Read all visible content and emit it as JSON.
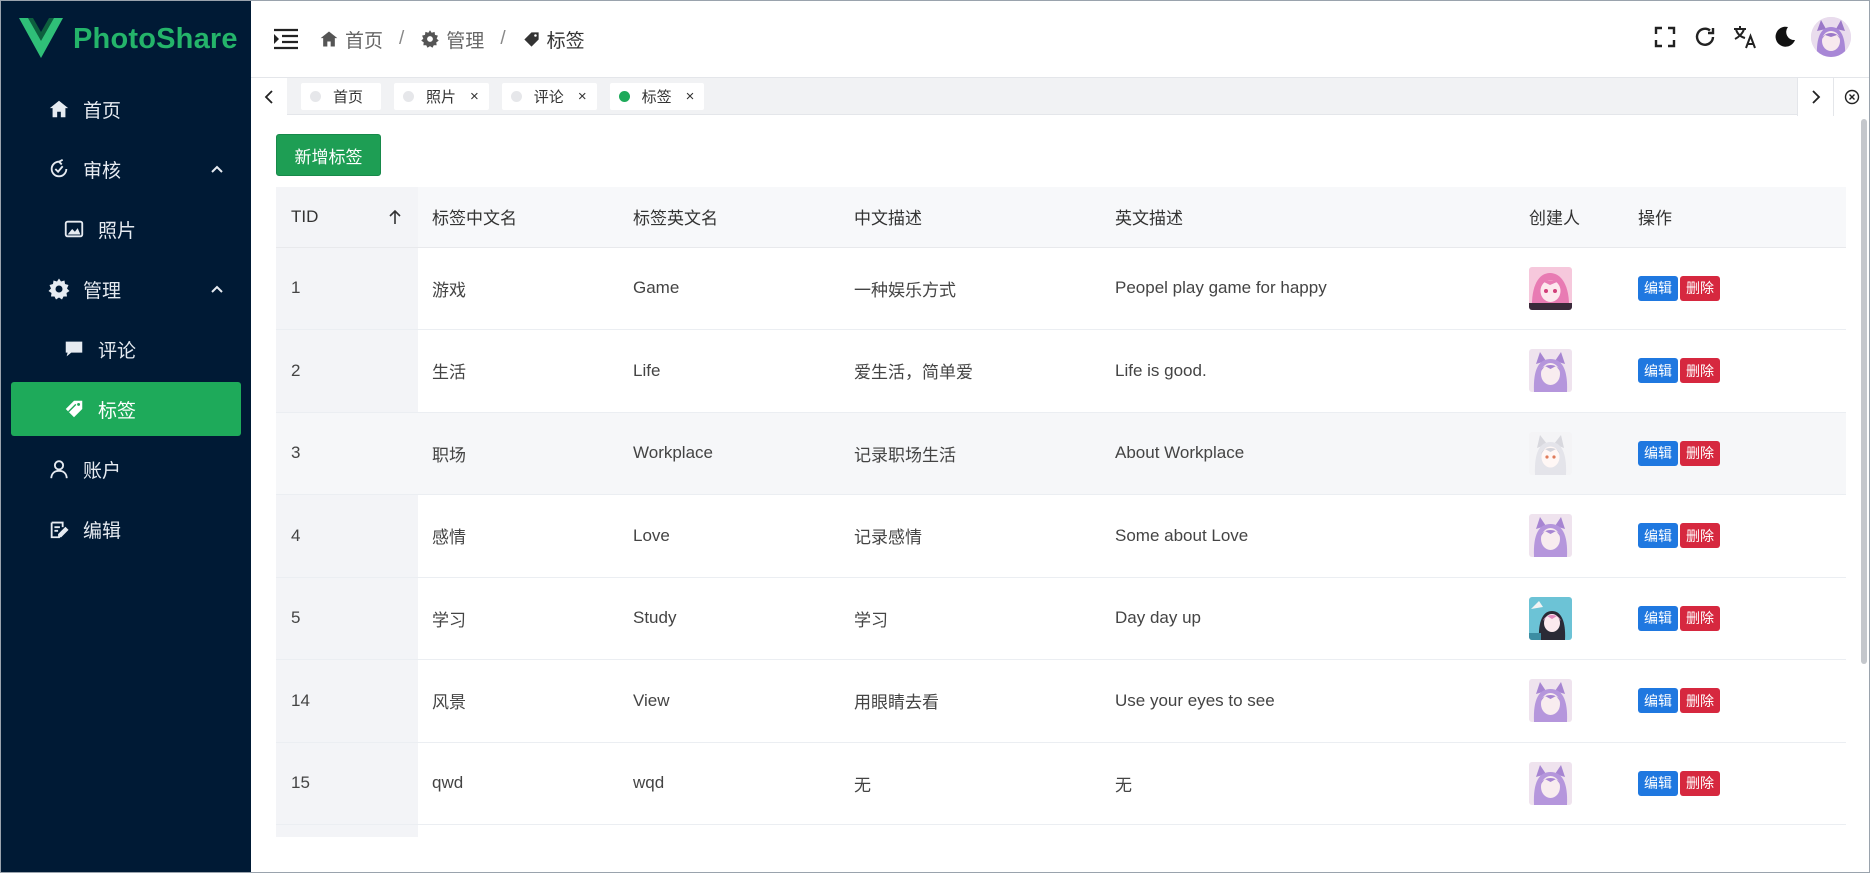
{
  "app": {
    "brand": "PhotoShare",
    "colors": {
      "sidebar_bg": "#001a35",
      "accent": "#1eaa5a",
      "edit": "#1f78e0",
      "delete": "#d6283f"
    }
  },
  "sidebar": {
    "items": [
      {
        "label": "首页",
        "icon": "home-icon"
      },
      {
        "label": "审核",
        "icon": "review-icon",
        "expanded": true
      },
      {
        "label": "照片",
        "icon": "image-icon",
        "sub": true
      },
      {
        "label": "管理",
        "icon": "gear-icon",
        "expanded": true
      },
      {
        "label": "评论",
        "icon": "comment-icon",
        "sub": true
      },
      {
        "label": "标签",
        "icon": "tag-icon",
        "sub": true,
        "active": true
      },
      {
        "label": "账户",
        "icon": "user-icon"
      },
      {
        "label": "编辑",
        "icon": "edit-icon"
      }
    ]
  },
  "header": {
    "breadcrumb": [
      {
        "label": "首页",
        "icon": "home-icon"
      },
      {
        "label": "管理",
        "icon": "gear-icon"
      },
      {
        "label": "标签",
        "icon": "tag-icon"
      }
    ],
    "separator": "/"
  },
  "tabs": [
    {
      "label": "首页",
      "closable": false,
      "active": false
    },
    {
      "label": "照片",
      "closable": true,
      "active": false
    },
    {
      "label": "评论",
      "closable": true,
      "active": false
    },
    {
      "label": "标签",
      "closable": true,
      "active": true
    }
  ],
  "toolbar": {
    "add_label": "新增标签"
  },
  "table": {
    "columns": [
      "TID",
      "标签中文名",
      "标签英文名",
      "中文描述",
      "英文描述",
      "创建人",
      "操作"
    ],
    "sort_column": "TID",
    "edit_label": "编辑",
    "delete_label": "删除",
    "rows": [
      {
        "tid": "1",
        "cn": "游戏",
        "en": "Game",
        "cdesc": "一种娱乐方式",
        "edesc": "Peopel play game for happy",
        "avatar": "pink-hair-avatar"
      },
      {
        "tid": "2",
        "cn": "生活",
        "en": "Life",
        "cdesc": "爱生活，简单爱",
        "edesc": "Life is good.",
        "avatar": "purple-cat-avatar"
      },
      {
        "tid": "3",
        "cn": "职场",
        "en": "Workplace",
        "cdesc": "记录职场生活",
        "edesc": "About Workplace",
        "avatar": "white-cat-avatar"
      },
      {
        "tid": "4",
        "cn": "感情",
        "en": "Love",
        "cdesc": "记录感情",
        "edesc": "Some about Love",
        "avatar": "purple-cat-avatar"
      },
      {
        "tid": "5",
        "cn": "学习",
        "en": "Study",
        "cdesc": "学习",
        "edesc": "Day day up",
        "avatar": "blue-bg-avatar"
      },
      {
        "tid": "14",
        "cn": "风景",
        "en": "View",
        "cdesc": "用眼睛去看",
        "edesc": "Use your eyes to see",
        "avatar": "purple-cat-avatar"
      },
      {
        "tid": "15",
        "cn": "qwd",
        "en": "wqd",
        "cdesc": "无",
        "edesc": "无",
        "avatar": "purple-cat-avatar"
      }
    ]
  }
}
